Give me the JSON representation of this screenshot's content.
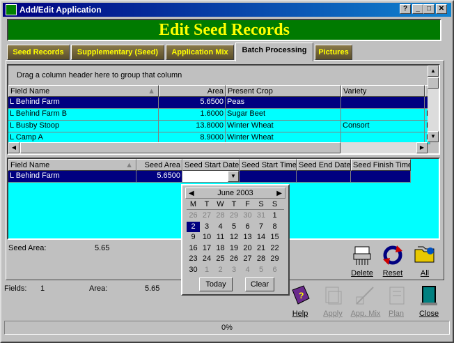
{
  "window": {
    "title": "Add/Edit Application"
  },
  "banner": {
    "title": "Edit Seed Records"
  },
  "tabs": [
    {
      "label": "Seed Records"
    },
    {
      "label": "Supplementary (Seed)"
    },
    {
      "label": "Application Mix"
    },
    {
      "label": "Batch Processing"
    },
    {
      "label": "Pictures"
    }
  ],
  "grid1": {
    "group_hint": "Drag a column header here to group that column",
    "headers": [
      "Field Name",
      "Area",
      "Present Crop",
      "Variety",
      "H"
    ],
    "rows": [
      {
        "field": "L Behind Farm",
        "area": "5.6500",
        "crop": "Peas",
        "variety": "",
        "h": ""
      },
      {
        "field": "L Behind Farm B",
        "area": "1.6000",
        "crop": "Sugar Beet",
        "variety": "",
        "h": "L"
      },
      {
        "field": "L Busby Stoop",
        "area": "13.8000",
        "crop": "Winter Wheat",
        "variety": "Consort",
        "h": "L"
      },
      {
        "field": "L Camp A",
        "area": "8.9000",
        "crop": "Winter Wheat",
        "variety": "",
        "h": "L"
      }
    ]
  },
  "grid2": {
    "headers": [
      "Field Name",
      "Seed Area",
      "Seed Start Date",
      "Seed Start Time",
      "Seed End Date",
      "Seed Finish Time"
    ],
    "rows": [
      {
        "field": "L Behind Farm",
        "area": "5.6500"
      }
    ]
  },
  "calendar": {
    "month": "June 2003",
    "weekdays": [
      "M",
      "T",
      "W",
      "T",
      "F",
      "S",
      "S"
    ],
    "weeks": [
      [
        "26",
        "27",
        "28",
        "29",
        "30",
        "31",
        "1"
      ],
      [
        "2",
        "3",
        "4",
        "5",
        "6",
        "7",
        "8"
      ],
      [
        "9",
        "10",
        "11",
        "12",
        "13",
        "14",
        "15"
      ],
      [
        "16",
        "17",
        "18",
        "19",
        "20",
        "21",
        "22"
      ],
      [
        "23",
        "24",
        "25",
        "26",
        "27",
        "28",
        "29"
      ],
      [
        "30",
        "1",
        "2",
        "3",
        "4",
        "5",
        "6"
      ]
    ],
    "today_label": "Today",
    "clear_label": "Clear"
  },
  "summary": {
    "seed_area_label": "Seed Area:",
    "seed_area_value": "5.65",
    "fields_label": "Fields:",
    "fields_value": "1",
    "area_label": "Area:",
    "area_value": "5.65"
  },
  "actions": {
    "delete": "Delete",
    "reset": "Reset",
    "all": "All"
  },
  "toolbar": {
    "help": "Help",
    "apply": "Apply",
    "appmix": "App. Mix",
    "plan": "Plan",
    "close": "Close"
  },
  "status": {
    "progress": "0%"
  },
  "colors": {
    "banner_bg": "#007a00",
    "banner_text": "#ffff00",
    "selected_row": "#000080",
    "grid_bg": "#00ffff"
  }
}
